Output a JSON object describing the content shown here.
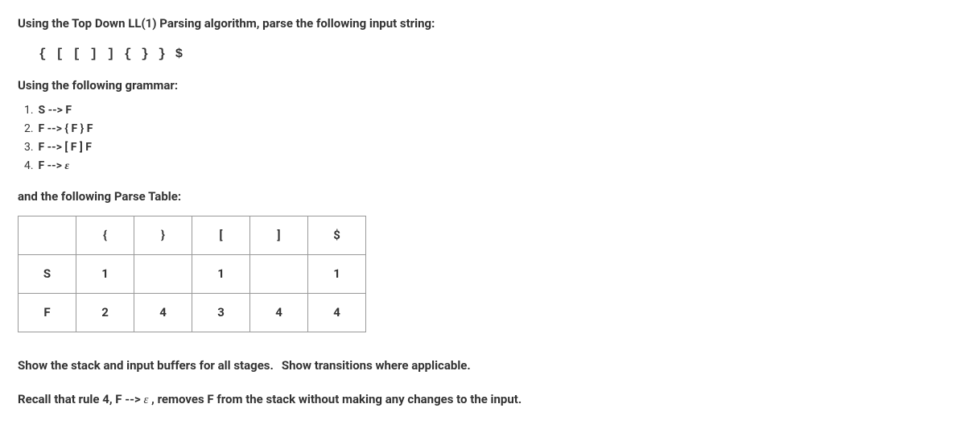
{
  "intro_line": "Using the Top Down LL(1) Parsing algorithm, parse the following input string:",
  "input_string": "{ [ [ ] ] { } } $",
  "grammar_intro": "Using the following grammar:",
  "grammar_rules": [
    {
      "num": "1.",
      "lhs": "S",
      "arrow": "-->",
      "rhs": "F"
    },
    {
      "num": "2.",
      "lhs": "F",
      "arrow": "-->",
      "rhs": "{ F } F"
    },
    {
      "num": "3.",
      "lhs": "F",
      "arrow": "-->",
      "rhs": "[ F ] F"
    },
    {
      "num": "4.",
      "lhs": "F",
      "arrow": "-->",
      "rhs": "ε"
    }
  ],
  "parse_intro": "and the following Parse Table:",
  "parse_table": {
    "header": [
      "",
      "{",
      "}",
      "[",
      "]",
      "$"
    ],
    "rows": [
      {
        "label": "S",
        "cells": [
          "1",
          "",
          "1",
          "",
          "1"
        ]
      },
      {
        "label": "F",
        "cells": [
          "2",
          "4",
          "3",
          "4",
          "4"
        ]
      }
    ]
  },
  "instruction_text_1": "Show the stack and input buffers for all stages.",
  "instruction_text_2": "Show transitions where applicable.",
  "recall_pre": "Recall that rule 4, F --> ",
  "recall_eps": "ε",
  "recall_post": " , removes F from the stack without making any changes to the input."
}
